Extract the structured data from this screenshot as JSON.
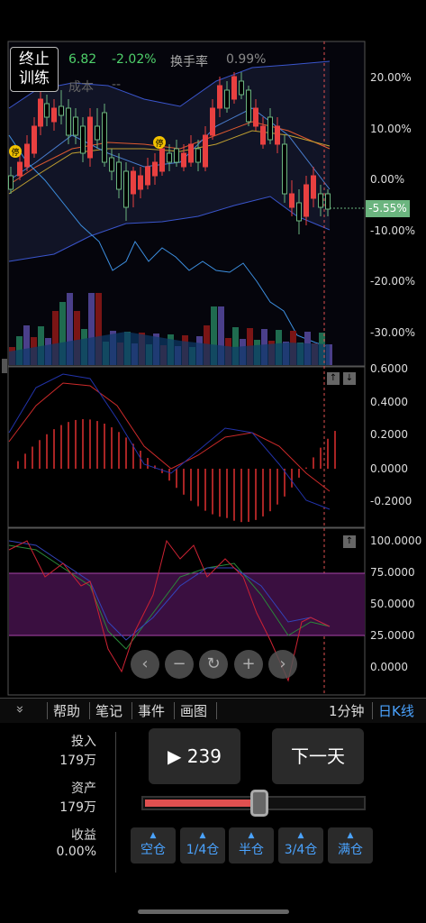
{
  "header": {
    "stop_label_line1": "终止",
    "stop_label_line2": "训练",
    "price": "6.82",
    "change_pct": "-2.02%",
    "turnover_label": "换手率",
    "turnover_value": "0.99%",
    "cost_label": "成本",
    "cost_value": "--",
    "current_pct_badge": "-5.55%"
  },
  "price_axis": [
    "20.00%",
    "10.00%",
    "0.00%",
    "-10.00%",
    "-20.00%",
    "-30.00%"
  ],
  "macd_axis": [
    "0.6000",
    "0.4000",
    "0.2000",
    "0.0000",
    "-0.2000"
  ],
  "kdj_axis": [
    "100.0000",
    "75.0000",
    "50.0000",
    "25.0000",
    "0.0000"
  ],
  "markers": {
    "halt_label": "停"
  },
  "zoom_controls": {
    "left": "‹",
    "minus": "−",
    "reset": "↻",
    "plus": "+",
    "right": "›"
  },
  "panel_controls": {
    "up": "↑",
    "down": "↓"
  },
  "toolbar": {
    "collapse": "»",
    "help": "帮助",
    "notes": "笔记",
    "events": "事件",
    "draw": "画图",
    "minute": "1分钟",
    "daily": "日K线"
  },
  "stats": {
    "invest_label": "投入",
    "invest_value": "179万",
    "assets_label": "资产",
    "assets_value": "179万",
    "return_label": "收益",
    "return_value": "0.00%"
  },
  "controls": {
    "play_label": "▶ 239",
    "next_day_label": "下一天",
    "speed_slider_fraction": 0.52
  },
  "positions": [
    "空仓",
    "1/4仓",
    "半仓",
    "3/4仓",
    "满仓"
  ],
  "colors": {
    "up": "#e84040",
    "down": "#6bb57f",
    "accent": "#4aa3ff",
    "change": "#4fd16b"
  }
}
